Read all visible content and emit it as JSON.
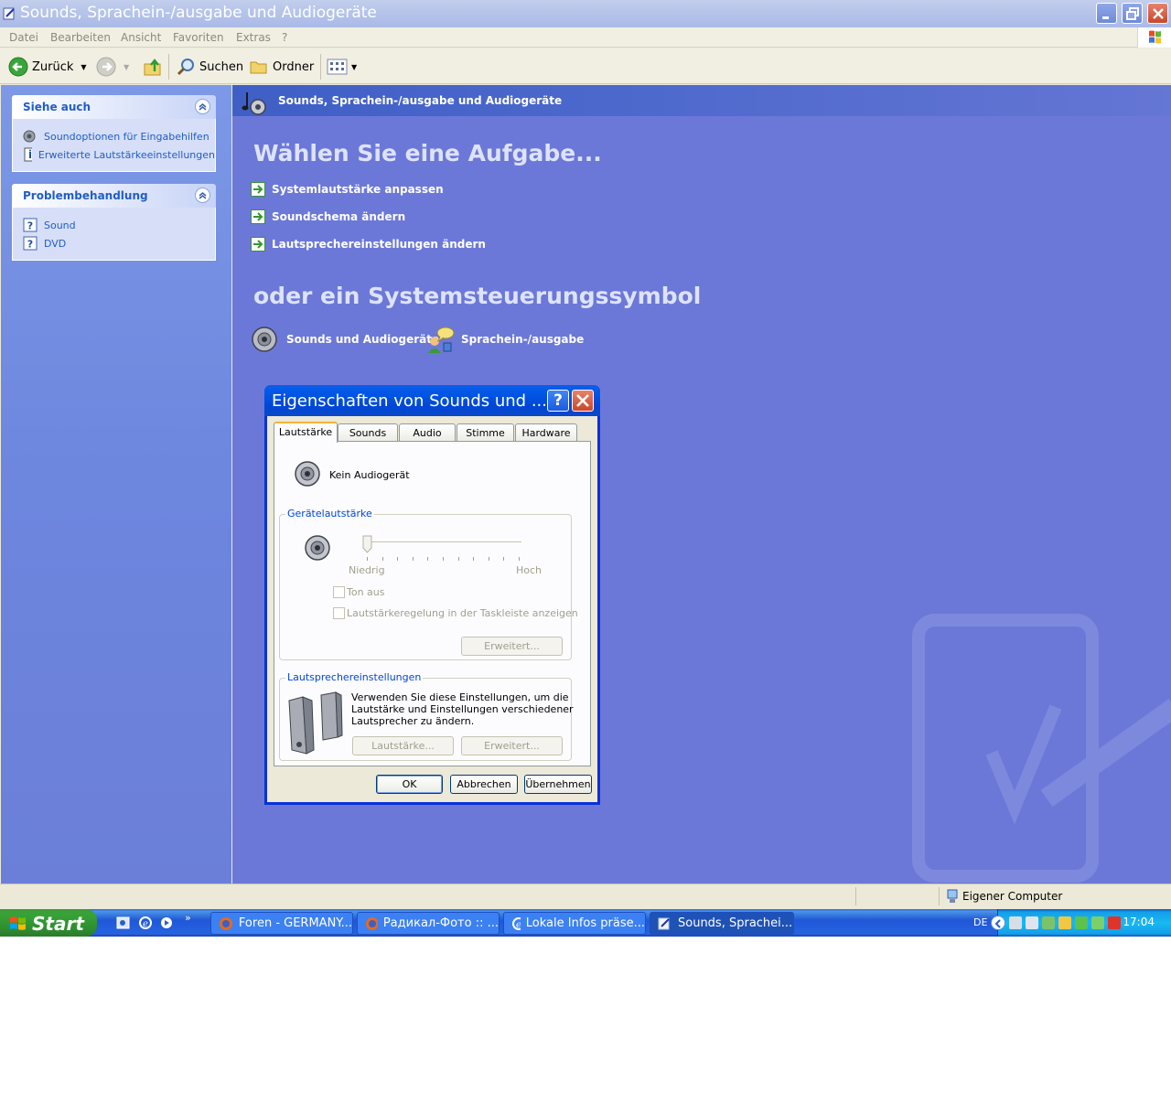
{
  "window": {
    "title": "Sounds, Sprachein-/ausgabe und Audiogeräte"
  },
  "menu": [
    "Datei",
    "Bearbeiten",
    "Ansicht",
    "Favoriten",
    "Extras",
    "?"
  ],
  "toolbar": {
    "back_label": "Zurück",
    "search_label": "Suchen",
    "folders_label": "Ordner"
  },
  "sidebar": {
    "see_also": {
      "title": "Siehe auch",
      "items": [
        "Soundoptionen für Eingabehilfen",
        "Erweiterte Lautstärkeeinstellungen"
      ]
    },
    "troubleshoot": {
      "title": "Problembehandlung",
      "items": [
        "Sound",
        "DVD"
      ]
    }
  },
  "main": {
    "header_title": "Sounds, Sprachein-/ausgabe und Audiogeräte",
    "pick_task": "Wählen Sie eine Aufgabe...",
    "tasks": [
      "Systemlautstärke anpassen",
      "Soundschema ändern",
      "Lautsprechereinstellungen ändern"
    ],
    "or_icon": "oder ein Systemsteuerungssymbol",
    "icons": [
      "Sounds und Audiogeräte",
      "Sprachein-/ausgabe"
    ]
  },
  "dialog": {
    "title": "Eigenschaften von Sounds und ...",
    "help_label": "?",
    "tabs": [
      "Lautstärke",
      "Sounds",
      "Audio",
      "Stimme",
      "Hardware"
    ],
    "active_tab": "Lautstärke",
    "device_name": "Kein Audiogerät",
    "volume_group": {
      "label": "Gerätelautstärke",
      "low_label": "Niedrig",
      "high_label": "Hoch",
      "slider_level": 0,
      "mute_label": "Ton aus",
      "taskbar_label": "Lautstärkeregelung in der Taskleiste anzeigen",
      "advanced_label": "Erweitert..."
    },
    "speaker_group": {
      "label": "Lautsprechereinstellungen",
      "description": [
        "Verwenden Sie diese Einstellungen, um die",
        "Lautstärke und Einstellungen verschiedener",
        "Lautsprecher zu ändern."
      ],
      "volume_label": "Lautstärke...",
      "advanced_label": "Erweitert..."
    },
    "ok_label": "OK",
    "cancel_label": "Abbrechen",
    "apply_label": "Übernehmen"
  },
  "statusbar": {
    "zone_label": "Eigener Computer"
  },
  "taskbar": {
    "start_label": "Start",
    "overflow_label": "»",
    "buttons": [
      "Foren - GERMANY...",
      "Радикал-Фото :: ...",
      "Lokale Infos präse...",
      "Sounds, Sprachei..."
    ],
    "language": "DE",
    "clock": "17:04"
  },
  "colors": {
    "content_bg": "#6c78d8",
    "header_band": "#4563c8",
    "dialog_title": "#0055e5",
    "taskbar": "#245edb",
    "start_button": "#37a337"
  }
}
